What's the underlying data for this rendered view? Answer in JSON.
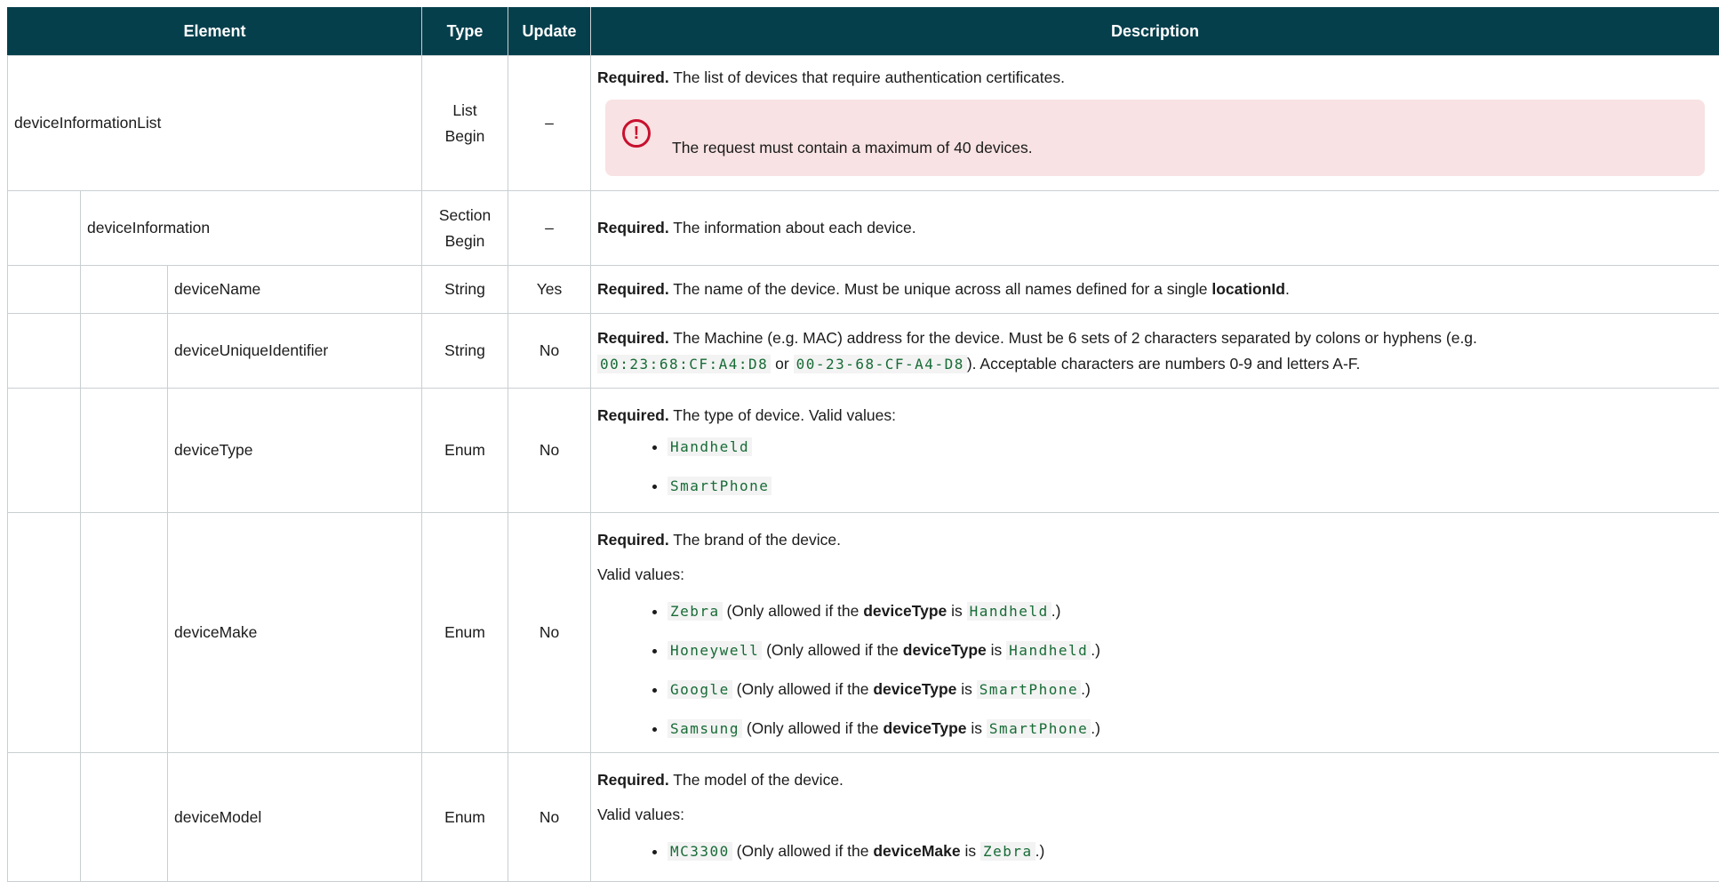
{
  "headers": {
    "element": "Element",
    "type": "Type",
    "update": "Update",
    "description": "Description"
  },
  "rows": {
    "r0": {
      "element": "deviceInformationList",
      "type_l1": "List",
      "type_l2": "Begin",
      "update": "–",
      "req": "Required.",
      "text": " The list of devices that require authentication certificates.",
      "note_icon": "alert-circle-icon",
      "note": "The request must contain a maximum of 40 devices."
    },
    "r1": {
      "element": "deviceInformation",
      "type_l1": "Section",
      "type_l2": "Begin",
      "update": "–",
      "req": "Required.",
      "text": " The information about each device."
    },
    "r2": {
      "element": "deviceName",
      "type": "String",
      "update": "Yes",
      "req": "Required.",
      "text": " The name of the device. Must be unique across all names defined for a single ",
      "bold": "locationId",
      "end": "."
    },
    "r3": {
      "element": "deviceUniqueIdentifier",
      "type": "String",
      "update": "No",
      "req": "Required.",
      "text": " The Machine (e.g. MAC) address for the device. Must be 6 sets of 2 characters separated by colons or hyphens (e.g.",
      "code1": "00:23:68:CF:A4:D8",
      "or": " or ",
      "code2": "00-23-68-CF-A4-D8",
      "end": "). Acceptable characters are numbers 0-9 and letters A-F."
    },
    "r4": {
      "element": "deviceType",
      "type": "Enum",
      "update": "No",
      "req": "Required.",
      "text": " The type of device. Valid values:",
      "values": [
        "Handheld",
        "SmartPhone"
      ]
    },
    "r5": {
      "element": "deviceMake",
      "type": "Enum",
      "update": "No",
      "req": "Required.",
      "text": " The brand of the device.",
      "valid": "Valid values:",
      "items": [
        {
          "code": "Zebra",
          "pre": " (Only allowed if the ",
          "bold": "deviceType",
          "is": " is ",
          "code2": "Handheld",
          "end": ".)"
        },
        {
          "code": "Honeywell",
          "pre": " (Only allowed if the ",
          "bold": "deviceType",
          "is": " is ",
          "code2": "Handheld",
          "end": ".)"
        },
        {
          "code": "Google",
          "pre": " (Only allowed if the ",
          "bold": "deviceType",
          "is": " is ",
          "code2": "SmartPhone",
          "end": ".)"
        },
        {
          "code": "Samsung",
          "pre": " (Only allowed if the ",
          "bold": "deviceType",
          "is": " is ",
          "code2": "SmartPhone",
          "end": ".)"
        }
      ]
    },
    "r6": {
      "element": "deviceModel",
      "type": "Enum",
      "update": "No",
      "req": "Required.",
      "text": " The model of the device.",
      "valid": "Valid values:",
      "items": [
        {
          "code": "MC3300",
          "pre": " (Only allowed if the ",
          "bold": "deviceMake",
          "is": " is ",
          "code2": "Zebra",
          "end": ".)"
        }
      ]
    }
  },
  "colors": {
    "header_bg": "#053f4c",
    "code_text": "#176b36",
    "note_bg": "#f8e2e3",
    "alert": "#c8102e"
  }
}
